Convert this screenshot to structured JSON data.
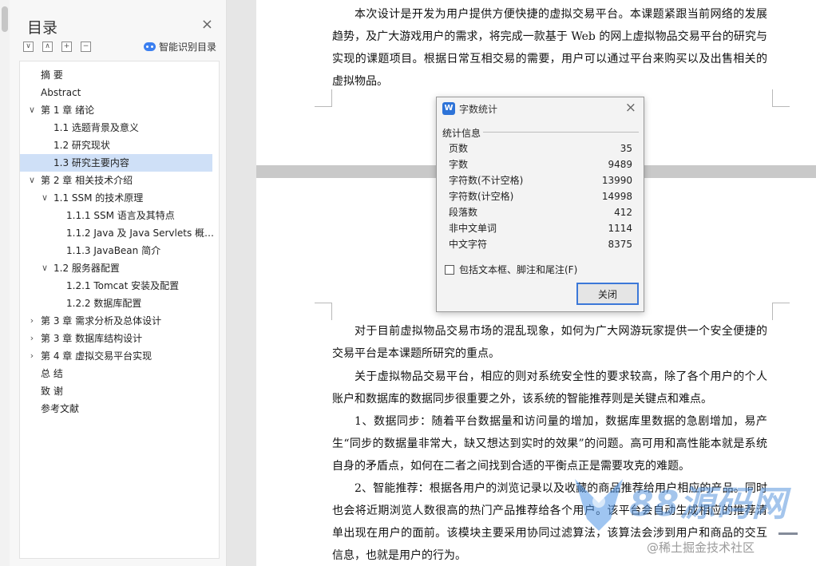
{
  "nav": {
    "title": "目录",
    "close_glyph": "×",
    "tools": [
      "∨",
      "∧",
      "+",
      "−"
    ],
    "smart_label": "智能识别目录",
    "items": [
      {
        "label": "摘 要",
        "level": 0,
        "toggle": ""
      },
      {
        "label": "Abstract",
        "level": 0,
        "toggle": ""
      },
      {
        "label": "第 1 章  绪论",
        "level": 0,
        "toggle": "∨"
      },
      {
        "label": "1.1 选题背景及意义",
        "level": 1,
        "toggle": ""
      },
      {
        "label": "1.2 研究现状",
        "level": 1,
        "toggle": ""
      },
      {
        "label": "1.3 研究主要内容",
        "level": 1,
        "toggle": "",
        "selected": true
      },
      {
        "label": "第 2 章  相关技术介绍",
        "level": 0,
        "toggle": "∨"
      },
      {
        "label": "1.1 SSM 的技术原理",
        "level": 1,
        "toggle": "∨"
      },
      {
        "label": "1.1.1 SSM 语言及其特点",
        "level": 2,
        "toggle": ""
      },
      {
        "label": "1.1.2 Java 及 Java Servlets 概…",
        "level": 2,
        "toggle": ""
      },
      {
        "label": "1.1.3 JavaBean 简介",
        "level": 2,
        "toggle": ""
      },
      {
        "label": "1.2  服务器配置",
        "level": 1,
        "toggle": "∨"
      },
      {
        "label": "1.2.1 Tomcat 安装及配置",
        "level": 2,
        "toggle": ""
      },
      {
        "label": "1.2.2  数据库配置",
        "level": 2,
        "toggle": ""
      },
      {
        "label": "第 3 章  需求分析及总体设计",
        "level": 0,
        "toggle": "›"
      },
      {
        "label": "第 3 章  数据库结构设计",
        "level": 0,
        "toggle": "›"
      },
      {
        "label": "第 4 章  虚拟交易平台实现",
        "level": 0,
        "toggle": "›"
      },
      {
        "label": "总  结",
        "level": 0,
        "toggle": ""
      },
      {
        "label": "致  谢",
        "level": 0,
        "toggle": ""
      },
      {
        "label": "参考文献",
        "level": 0,
        "toggle": ""
      }
    ]
  },
  "doc": {
    "p1": "本次设计是开发为用户提供方便快捷的虚拟交易平台。本课题紧跟当前网络的发展趋势，及广大游戏用户的需求，将完成一款基于 Web 的网上虚拟物品交易平台的研究与实现的课题项目。根据日常互相交易的需要，用户可以通过平台来购买以及出售相关的虚拟物品。",
    "p2": "对于目前虚拟物品交易市场的混乱现象，如何为广大网游玩家提供一个安全便捷的交易平台是本课题所研究的重点。",
    "p3": "关于虚拟物品交易平台，相应的则对系统安全性的要求较高，除了各个用户的个人账户和数据库的数据同步很重要之外，该系统的智能推荐则是关键点和难点。",
    "p4": "1、数据同步：随着平台数据量和访问量的增加，数据库里数据的急剧增加，易产生“同步的数据量非常大，缺又想达到实时的效果”的问题。高可用和高性能本就是系统自身的矛盾点，如何在二者之间找到合适的平衡点正是需要攻克的难题。",
    "p5": "2、智能推荐：根据各用户的浏览记录以及收藏的商品推荐给用户相应的产品。同时也会将近期浏览人数很高的热门产品推荐给各个用户。该平台会自动生成相应的推荐清单出现在用户的面前。该模块主要采用协同过滤算法，该算法会涉到用户和商品的交互信息，也就是用户的行为。"
  },
  "dialog": {
    "icon_letter": "W",
    "title": "字数统计",
    "close_glyph": "×",
    "section": "统计信息",
    "stats": [
      {
        "label": "页数",
        "value": "35"
      },
      {
        "label": "字数",
        "value": "9489"
      },
      {
        "label": "字符数(不计空格)",
        "value": "13990"
      },
      {
        "label": "字符数(计空格)",
        "value": "14998"
      },
      {
        "label": "段落数",
        "value": "412"
      },
      {
        "label": "非中文单词",
        "value": "1114"
      },
      {
        "label": "中文字符",
        "value": "8375"
      }
    ],
    "checkbox_label": "包括文本框、脚注和尾注(F)",
    "checkbox_checked": false,
    "close_button": "关闭"
  },
  "watermark": {
    "big": "88源码网",
    "small": "@稀土掘金技术社区"
  }
}
